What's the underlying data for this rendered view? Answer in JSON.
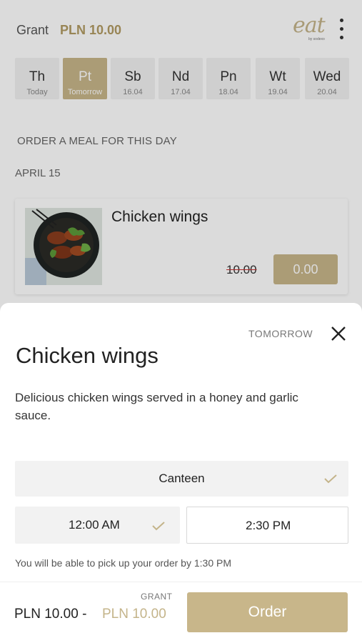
{
  "header": {
    "grant_label": "Grant",
    "grant_amount": "PLN 10.00",
    "logo_text": "eat",
    "logo_subtext": "by sodexo"
  },
  "days": [
    {
      "name": "Th",
      "date": "Today"
    },
    {
      "name": "Pt",
      "date": "Tomorrow",
      "selected": true
    },
    {
      "name": "Sb",
      "date": "16.04"
    },
    {
      "name": "Nd",
      "date": "17.04"
    },
    {
      "name": "Pn",
      "date": "18.04"
    },
    {
      "name": "Wt",
      "date": "19.04"
    },
    {
      "name": "Wed",
      "date": "20.04"
    }
  ],
  "section_heading": "ORDER A MEAL FOR THIS DAY",
  "date_heading": "APRIL 15",
  "meal_card": {
    "title": "Chicken wings",
    "old_price": "10.00",
    "price": "0.00"
  },
  "sheet": {
    "tag": "TOMORROW",
    "title": "Chicken wings",
    "description": "Delicious chicken wings served in a honey and garlic sauce.",
    "location": "Canteen",
    "time_options": [
      "12:00 AM",
      "2:30 PM"
    ],
    "pickup_note": "You will be able to pick up your order by 1:30 PM"
  },
  "footer": {
    "grant_caption": "GRANT",
    "total_price": "PLN 10.00 -",
    "grant_price": "PLN 10.00",
    "order_label": "Order"
  },
  "colors": {
    "accent": "#c8b68a",
    "grant_text": "#b29b63"
  }
}
